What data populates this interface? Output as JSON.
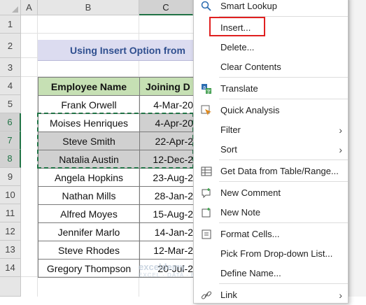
{
  "columns": [
    "A",
    "B",
    "C"
  ],
  "rows": [
    "1",
    "2",
    "3",
    "4",
    "5",
    "6",
    "7",
    "8",
    "9",
    "10",
    "11",
    "12",
    "13",
    "14"
  ],
  "title": "Using Insert Option from",
  "table": {
    "headers": [
      "Employee Name",
      "Joining D"
    ],
    "rows": [
      {
        "name": "Frank Orwell",
        "date": "4-Mar-20"
      },
      {
        "name": "Moises Henriques",
        "date": "4-Apr-20"
      },
      {
        "name": "Steve Smith",
        "date": "22-Apr-2"
      },
      {
        "name": "Natalia Austin",
        "date": "12-Dec-2"
      },
      {
        "name": "Angela Hopkins",
        "date": "23-Aug-2"
      },
      {
        "name": "Nathan Mills",
        "date": "28-Jan-2"
      },
      {
        "name": "Alfred Moyes",
        "date": "15-Aug-2"
      },
      {
        "name": "Jennifer Marlo",
        "date": "14-Jan-2"
      },
      {
        "name": "Steve Rhodes",
        "date": "12-Mar-2"
      },
      {
        "name": "Gregory Thompson",
        "date": "20-Jul-2"
      }
    ]
  },
  "context_menu": {
    "items": [
      {
        "label": "Smart Lookup",
        "icon": "info-search-icon"
      },
      {
        "label": "Insert...",
        "icon": ""
      },
      {
        "label": "Delete...",
        "icon": ""
      },
      {
        "label": "Clear Contents",
        "icon": ""
      },
      {
        "label": "Translate",
        "icon": "translate-icon"
      },
      {
        "label": "Quick Analysis",
        "icon": "quick-analysis-icon"
      },
      {
        "label": "Filter",
        "icon": "",
        "submenu": true
      },
      {
        "label": "Sort",
        "icon": "",
        "submenu": true
      },
      {
        "label": "Get Data from Table/Range...",
        "icon": "table-icon"
      },
      {
        "label": "New Comment",
        "icon": "new-comment-icon"
      },
      {
        "label": "New Note",
        "icon": "new-note-icon"
      },
      {
        "label": "Format Cells...",
        "icon": "format-cells-icon"
      },
      {
        "label": "Pick From Drop-down List...",
        "icon": ""
      },
      {
        "label": "Define Name...",
        "icon": ""
      },
      {
        "label": "Link",
        "icon": "link-icon",
        "submenu": true
      }
    ],
    "arrow": "›"
  },
  "watermark": {
    "main": "exceldemy",
    "sub": "EXCEL · DATA · BI"
  },
  "colors": {
    "accent": "#217346",
    "highlight": "#e02020",
    "header_fill": "#c6e0b4",
    "title_fill": "#dcdcf0"
  }
}
